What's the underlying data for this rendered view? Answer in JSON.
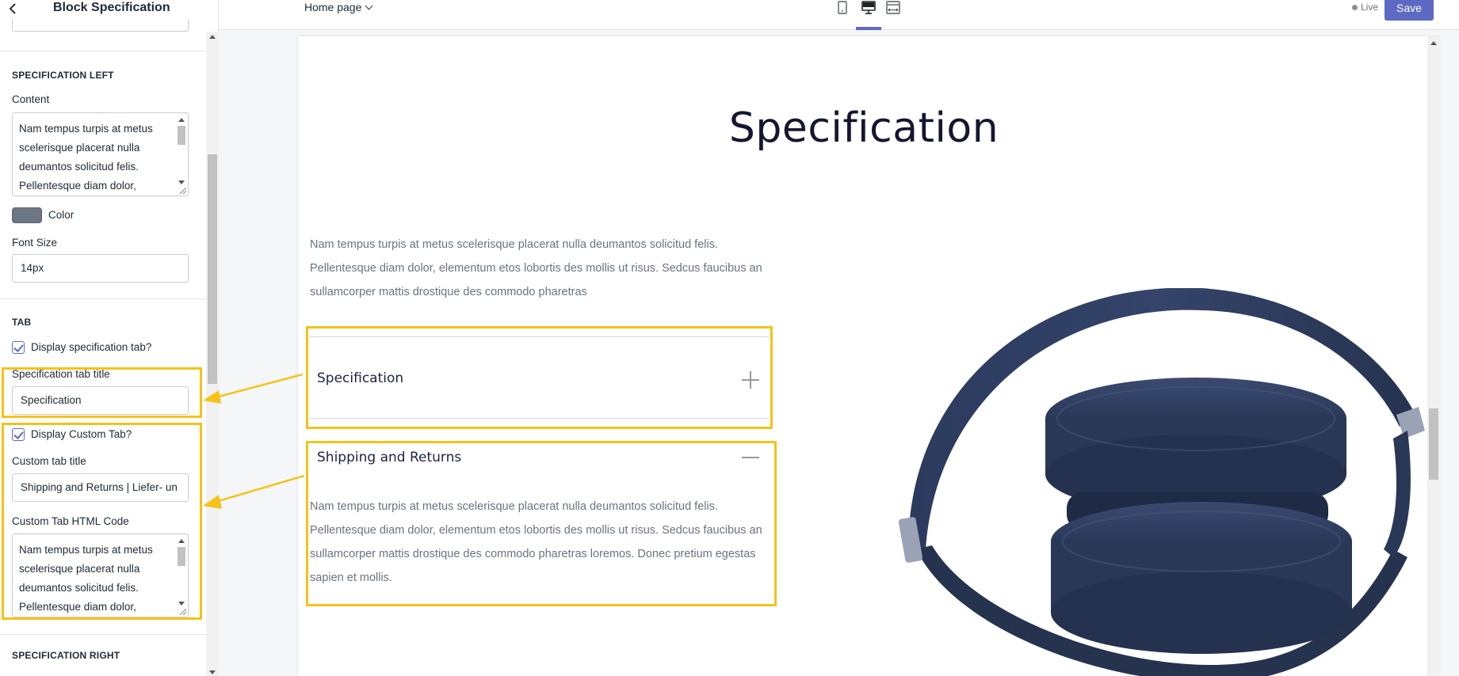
{
  "sidebar": {
    "title": "Block Specification",
    "specification_left": {
      "section_title": "SPECIFICATION LEFT",
      "content_label": "Content",
      "content_value": "Nam tempus turpis at metus scelerisque placerat nulla deumantos solicitud felis. Pellentesque diam dolor,",
      "color_label": "Color",
      "color_value": "#6d7684",
      "font_size_label": "Font Size",
      "font_size_value": "14px"
    },
    "tab": {
      "section_title": "TAB",
      "display_spec_tab_label": "Display specification tab?",
      "display_spec_tab_checked": true,
      "spec_tab_title_label": "Specification tab title",
      "spec_tab_title_value": "Specification",
      "display_custom_tab_label": "Display Custom Tab?",
      "display_custom_tab_checked": true,
      "custom_tab_title_label": "Custom tab title",
      "custom_tab_title_value": "Shipping and Returns | Liefer- un",
      "custom_tab_html_label": "Custom Tab HTML Code",
      "custom_tab_html_value": "Nam tempus turpis at metus scelerisque placerat nulla deumantos solicitud felis. Pellentesque diam dolor,"
    },
    "specification_right": {
      "section_title": "SPECIFICATION RIGHT"
    }
  },
  "topbar": {
    "page_selector": "Home page",
    "devices": [
      "mobile-icon",
      "desktop-icon",
      "fullwidth-icon"
    ],
    "active_device": "desktop-icon",
    "status": "Live",
    "save_label": "Save"
  },
  "preview": {
    "heading": "Specification",
    "intro_text": "Nam tempus turpis at metus scelerisque placerat nulla deumantos solicitud felis. Pellentesque diam dolor, elementum etos lobortis des mollis ut risus. Sedcus faucibus an sullamcorper mattis drostique des commodo pharetras",
    "spec_tab_title": "Specification",
    "custom_tab_title": "Shipping and Returns",
    "custom_tab_text": "Nam tempus turpis at metus scelerisque placerat nulla deumantos solicitud felis. Pellentesque diam dolor, elementum etos lobortis des mollis ut risus. Sedcus faucibus an sullamcorper mattis drostique des commodo pharetras loremos. Donec pretium egestas sapien et mollis.",
    "image": "headphones-image"
  },
  "colors": {
    "accent": "#5c6ac4",
    "highlight": "#f5c219",
    "headphone": "#2d3b5e"
  }
}
